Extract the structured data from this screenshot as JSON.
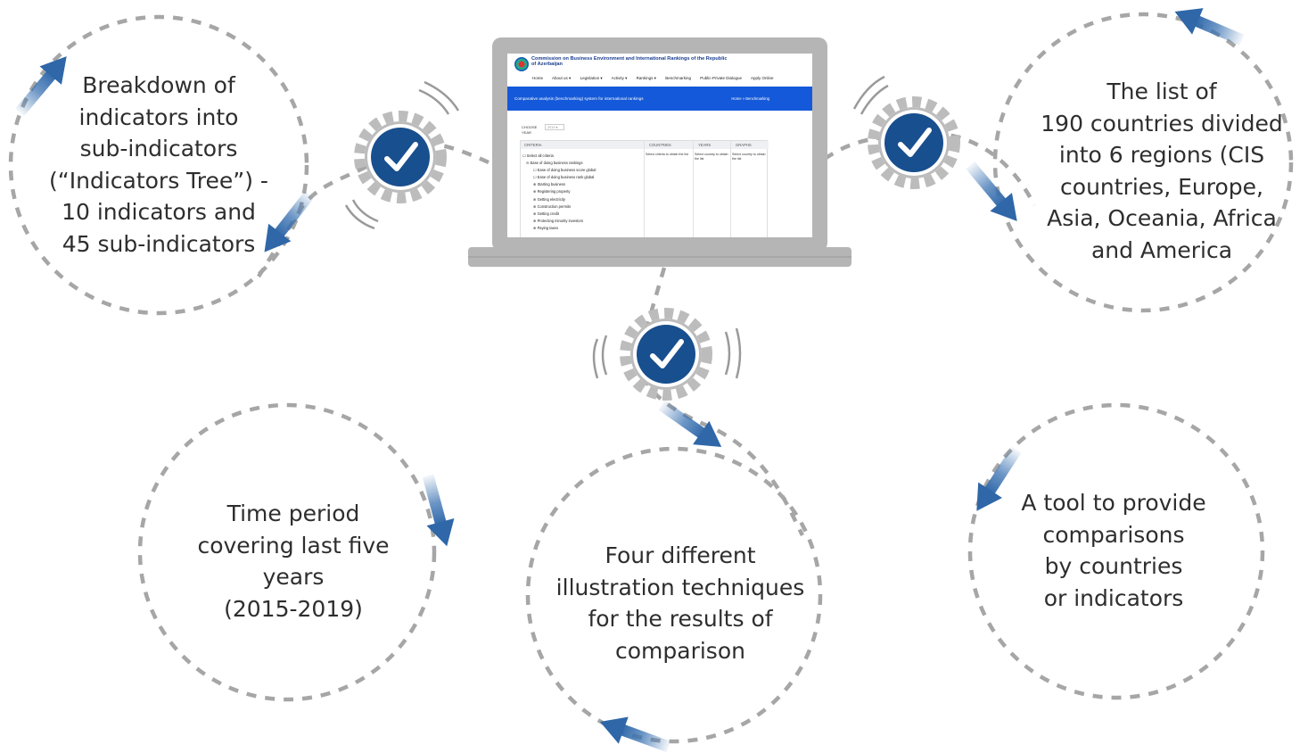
{
  "bubbles": {
    "b1": [
      "Breakdown of",
      "indicators into",
      "sub-indicators",
      "(“Indicators Tree”) -",
      "10 indicators and",
      "45 sub-indicators"
    ],
    "b2": [
      "The list of",
      "190 countries divided",
      "into 6 regions (CIS",
      "countries, Europe,",
      "Asia, Oceania, Africa",
      "and America"
    ],
    "b3": [
      "Time period",
      "covering last five",
      "years",
      "(2015-2019)"
    ],
    "b4": [
      "Four different",
      "illustration techniques",
      "for the results of",
      "comparison"
    ],
    "b5": [
      "A tool to provide",
      "comparisons",
      "by countries",
      "or indicators"
    ]
  },
  "screen": {
    "org_title": "Commission on Business Environment and International Rankings of the Republic of Azerbaijan",
    "nav": [
      "Home",
      "About us ▾",
      "Legislation ▾",
      "Activity ▾",
      "Rankings ▾",
      "Benchmarking",
      "Public-Private Dialogue",
      "Apply Online"
    ],
    "band_title": "Comparative analysis (benchmarking) system for international rankings",
    "band_crumb": "Home  »  Benchmarking",
    "choose_label": "CHOOSE\nYEAR",
    "year_value": "2019  ▾",
    "headers": [
      "CRITERIA",
      "COUNTRIES",
      "YEARS",
      "GRAPHS"
    ],
    "cells": [
      "Select criteria to obtain the list",
      "Select country to obtain the list",
      "Select country to obtain the list"
    ],
    "tree": [
      "☐ Select all criteria",
      "⊖ Ease of doing business rankings",
      "☐ Ease of doing business score global",
      "☐ Ease of doing business rank global",
      "⊕ Starting business",
      "⊕ Registering property",
      "⊕ Getting electricity",
      "⊕ Construction permits",
      "⊕ Getting credit",
      "⊕ Protecting minority investors",
      "⊕ Paying taxes"
    ]
  },
  "colors": {
    "dash": "#a6a6a6",
    "gear": "#bcbcbc",
    "check_disc": "#184f8e",
    "arrow": "#3a72b2",
    "text": "#2e2e2e",
    "laptop": "#b5b5b5",
    "band": "#1459d9"
  },
  "icons": [
    "gear-check-icon",
    "arrow-icon",
    "laptop-icon"
  ]
}
